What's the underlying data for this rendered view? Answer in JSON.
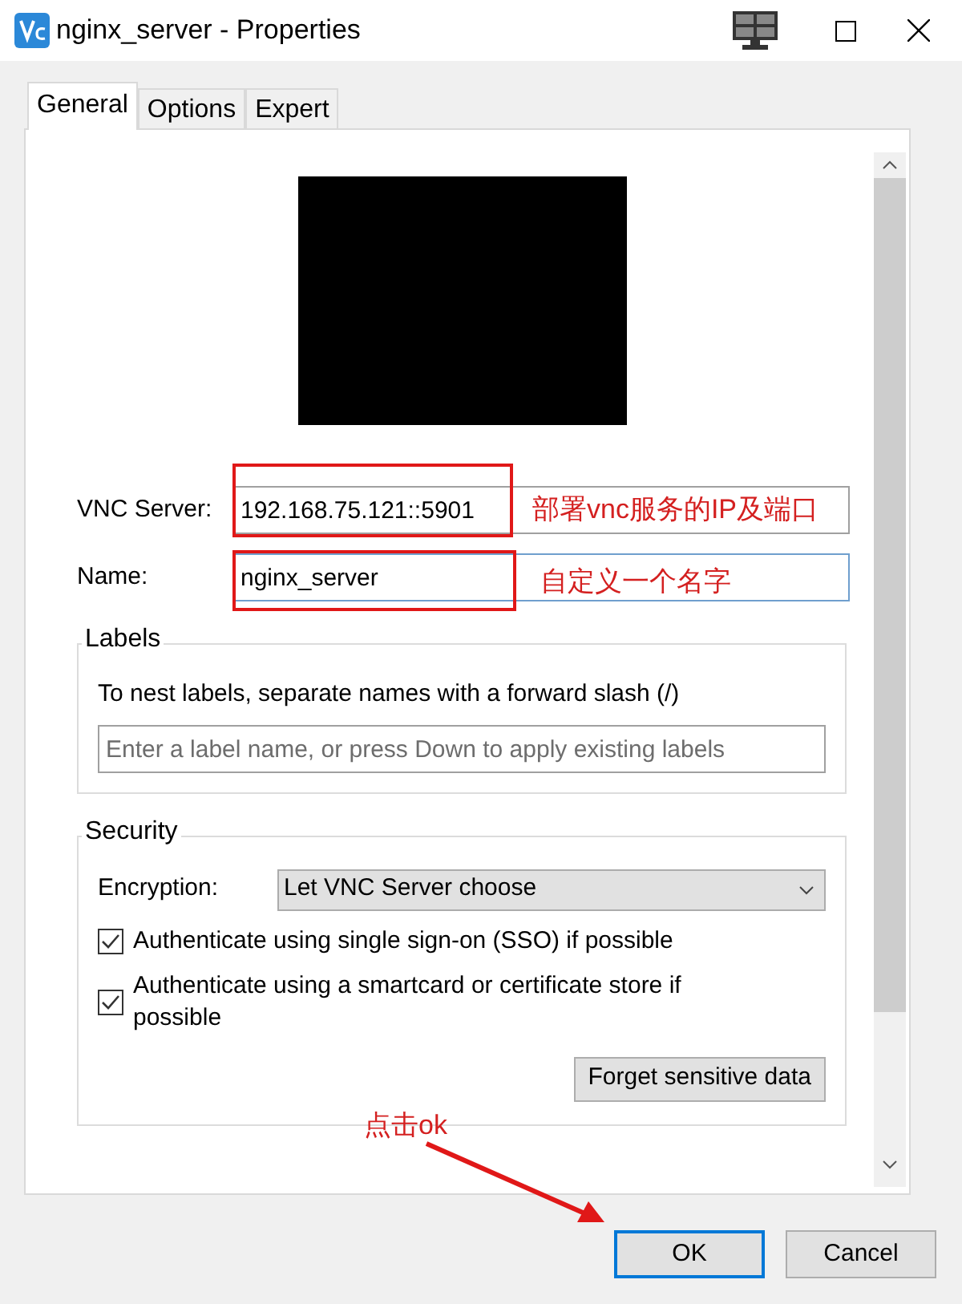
{
  "window": {
    "title": "nginx_server - Properties"
  },
  "tabs": [
    {
      "label": "General",
      "selected": true
    },
    {
      "label": "Options",
      "selected": false
    },
    {
      "label": "Expert",
      "selected": false
    }
  ],
  "fields": [
    {
      "label": "VNC Server:",
      "value": "192.168.75.121::5901",
      "focused": false
    },
    {
      "label": "Name:",
      "value": "nginx_server",
      "focused": true
    }
  ],
  "labels_group": {
    "title": "Labels",
    "hint": "To nest labels, separate names with a forward slash (/)",
    "placeholder": "Enter a label name, or press Down to apply existing labels"
  },
  "security": {
    "title": "Security",
    "encryption_label": "Encryption:",
    "encryption_value": "Let VNC Server choose",
    "options": [
      {
        "text": "Authenticate using single sign-on (SSO) if possible",
        "checked": true
      },
      {
        "text": "Authenticate using a smartcard or certificate store if possible",
        "checked": true
      }
    ],
    "button": "Forget sensitive data"
  },
  "buttons": [
    {
      "label": "OK",
      "default": true
    },
    {
      "label": "Cancel",
      "default": false
    }
  ],
  "annotations": [
    {
      "kind": "box-note",
      "text": "部署vnc服务的IP及端口"
    },
    {
      "kind": "box-note",
      "text": "自定义一个名字"
    },
    {
      "kind": "arrow-note",
      "text": "点击ok"
    }
  ]
}
